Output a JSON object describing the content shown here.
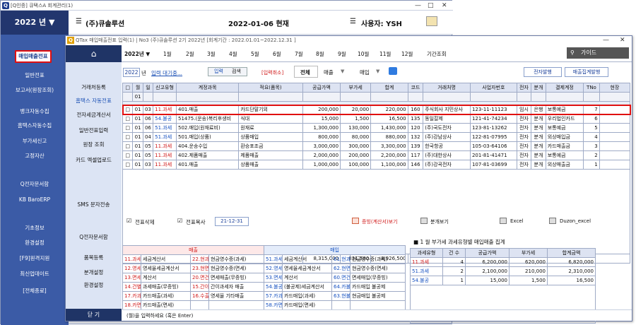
{
  "bg": {
    "title": "[Q인증] 큐택스A  회계관리(1)",
    "year": "2022 년 ▼",
    "company": "(주)큐솔루션",
    "date": "2022-01-06 현재",
    "user": "사용자: YSH",
    "nav": [
      "매입매출전표",
      "일반전표",
      "보고서(원장조회)",
      "뱅크자동수집",
      "홈택스자동수집",
      "부가세신고",
      "고정자산",
      "Q전자문서함",
      "KB BaroERP",
      "기초정보",
      "환경설정",
      "[F9]원격지원",
      "최신업데이트",
      "[전체종료]"
    ]
  },
  "fg": {
    "title": "QTax 매입매출전표 입력(1) | No3 (주)큐솔루션 2기 2022년 [회계기간 : 2022.01.01~2022.12.31 ]",
    "home_icon": "home-icon",
    "side": [
      "거래처등록",
      "홈택스 자동전표",
      "전자세금계산서",
      "일반전표입력",
      "원장 조회",
      "카드 엑셀업로드",
      "SMS 문자전송",
      "Q전자문서함",
      "품목등록",
      "분개설정",
      "환경설정"
    ],
    "close": "닫 기",
    "year": "2022년 ▼",
    "months": [
      "1월",
      "2월",
      "3월",
      "4월",
      "5월",
      "6월",
      "7월",
      "8월",
      "9월",
      "10월",
      "11월",
      "12월",
      "기간조회"
    ],
    "guide": "가이드",
    "year_box": "2022",
    "year_suffix": "년",
    "pending": "입력 대기중...",
    "tab_input": "입력",
    "tab_search": "검색",
    "cancel_input": "[입력취소]",
    "f_all": "전체",
    "f_sale": "매출",
    "f_buy": "매입",
    "btn_issue": "전자발행",
    "btn_agg": "매출집계발행"
  },
  "grid": {
    "headers": [
      "□",
      "월",
      "일",
      "신고유형",
      "계정과목",
      "적요(품목)",
      "공급가액",
      "부가세",
      "합계",
      "코드",
      "거래처명",
      "사업자번호",
      "전자",
      "분개",
      "결제계정",
      "TNo",
      "현장"
    ],
    "input_row": {
      "month": "01"
    },
    "rows": [
      [
        "□",
        "01",
        "03",
        "11.과세",
        "401.매출",
        "카드단말기외",
        "200,000",
        "20,000",
        "220,000",
        "160",
        "주식회사 지민상사",
        "123-11-11123",
        "임시",
        "은행",
        "보통예금",
        "7",
        ""
      ],
      [
        "□",
        "01",
        "06",
        "54.불공",
        "51475.(운송)복리후생비",
        "식대",
        "15,000",
        "1,500",
        "16,500",
        "135",
        "동일칼제",
        "121-41-74234",
        "전자",
        "분개",
        "우리법인카드",
        "6",
        ""
      ],
      [
        "□",
        "01",
        "06",
        "51.과세",
        "502.매입(원재료비)",
        "원재료",
        "1,300,000",
        "130,000",
        "1,430,000",
        "120",
        "(주)국도전자",
        "123-81-13262",
        "전자",
        "분개",
        "보통예금",
        "5",
        ""
      ],
      [
        "□",
        "01",
        "04",
        "51.과세",
        "501.매입(상품)",
        "상품매입",
        "800,000",
        "80,000",
        "880,000",
        "132",
        "(주)강남상사",
        "122-81-07995",
        "전자",
        "분개",
        "외상매입금",
        "4",
        ""
      ],
      [
        "□",
        "01",
        "05",
        "11.과세",
        "404.운송수입",
        "환승포조금",
        "3,000,000",
        "300,000",
        "3,300,000",
        "139",
        "한국항공",
        "105-03-64106",
        "전자",
        "분개",
        "카드매출금",
        "3",
        ""
      ],
      [
        "□",
        "01",
        "05",
        "11.과세",
        "402.제품매출",
        "제품매출",
        "2,000,000",
        "200,000",
        "2,200,000",
        "117",
        "(주)대한상사",
        "201-81-41471",
        "전자",
        "분개",
        "보통예금",
        "2",
        ""
      ],
      [
        "□",
        "01",
        "03",
        "11.과세",
        "401.매출",
        "상품매출",
        "1,000,000",
        "100,000",
        "1,100,000",
        "146",
        "(주)강곡전자",
        "107-81-03699",
        "전자",
        "분개",
        "외상매출금",
        "1",
        ""
      ]
    ],
    "totals": {
      "supply": "8,315,000",
      "vat": "831,500",
      "total": "8,926,500"
    }
  },
  "toolbar": {
    "delete": "전표삭제",
    "copy": "전표복사",
    "copy_date": "21-12-31",
    "proof": "증빙(계산서)보기",
    "view": "분개보기",
    "excel": "Excel",
    "duzon": "Duzon_excel"
  },
  "types": {
    "sale_title": "매출",
    "buy_title": "매입",
    "sale": [
      [
        "11.과세",
        "세금계산서",
        "22.현과",
        "현금영수증(과세)"
      ],
      [
        "12.영세",
        "영세율세금계산서",
        "23.현면",
        "현금영수증(면세)"
      ],
      [
        "13.면세",
        "계산서",
        "20.면건",
        "면세매출(무증빙)"
      ],
      [
        "14.건별",
        "과세매출(무증빙)",
        "15.간이",
        "간이과세자 매출"
      ],
      [
        "17.카과",
        "카드매출(과세)",
        "16.수출",
        "영세율 기타매출"
      ],
      [
        "18.카면",
        "카드매출(면세)",
        "",
        ""
      ]
    ],
    "buy": [
      [
        "51.과세",
        "세금계산서",
        "61.현과",
        "현금영수증(과세)"
      ],
      [
        "52.영세",
        "영세율세금계산서",
        "62.현면",
        "현금영수증(면세)"
      ],
      [
        "53.면세",
        "계산서",
        "60.면건",
        "면세매입(무증빙)"
      ],
      [
        "54.불공",
        "(불공제)세금계산서",
        "64.카불",
        "카드매입 불공제"
      ],
      [
        "57.카과",
        "카드매입(과세)",
        "63.현불",
        "현금매입 불공제"
      ],
      [
        "58.카면",
        "카드매입(면세)",
        "",
        ""
      ]
    ]
  },
  "summary": {
    "title": "1 월 부가세 과세유형별 매입매출 집계",
    "month": "1",
    "headers": [
      "과세유형",
      "건 수",
      "공급가액",
      "부가세",
      "합계금액"
    ],
    "rows": [
      [
        "11.과세",
        "4",
        "6,200,000",
        "620,000",
        "6,820,000"
      ],
      [
        "51.과세",
        "2",
        "2,100,000",
        "210,000",
        "2,310,000"
      ],
      [
        "54.불공",
        "1",
        "15,000",
        "1,500",
        "16,500"
      ]
    ]
  },
  "status": "(월)을 입력하세요 (혹은 Enter)"
}
